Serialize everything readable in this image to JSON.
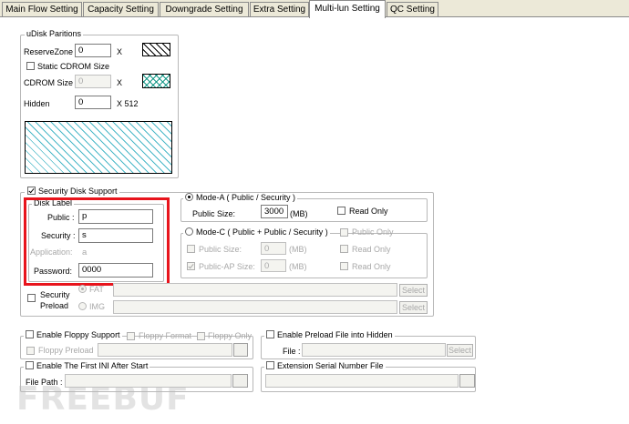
{
  "tabs": [
    {
      "label": "Main Flow Setting"
    },
    {
      "label": "Capacity Setting"
    },
    {
      "label": "Downgrade Setting"
    },
    {
      "label": "Extra Setting"
    },
    {
      "label": "Multi-lun Setting"
    },
    {
      "label": "QC Setting"
    }
  ],
  "udisk": {
    "title": "uDisk Paritions",
    "reserve_zone_label": "ReserveZone",
    "reserve_zone_value": "0",
    "x": "X",
    "static_cdrom_label": "Static CDROM Size",
    "cdrom_size_label": "CDROM Size",
    "cdrom_size_value": "0",
    "hidden_label": "Hidden",
    "hidden_value": "0",
    "x512": "X 512"
  },
  "security": {
    "title": "Security Disk Support",
    "disk_label_title": "Disk Label",
    "public_label": "Public :",
    "public_value": "p",
    "security_label": "Security :",
    "security_value": "s",
    "application_label": "Application:",
    "application_value": "a",
    "password_label": "Password:",
    "password_value": "0000",
    "mode_a_label": "Mode-A ( Public / Security )",
    "public_size_label": "Public Size:",
    "public_size_value": "3000",
    "mb": "(MB)",
    "read_only_label": "Read Only",
    "mode_c_label": "Mode-C ( Public + Public / Security )",
    "public_only_label": "Public Only",
    "mode_c_public_size_label": "Public Size:",
    "mode_c_public_size_value": "0",
    "mode_c_read_only_1": "Read Only",
    "public_ap_size_label": "Public-AP Size:",
    "public_ap_size_value": "0",
    "mode_c_read_only_2": "Read Only",
    "preload_label_1": "Security",
    "preload_label_2": "Preload",
    "fat_label": "FAT",
    "img_label": "IMG",
    "select_label": "Select"
  },
  "floppy": {
    "enable_label": "Enable Floppy Support",
    "floppy_format_label": "Floppy Format",
    "floppy_only_label": "Floppy Only",
    "floppy_preload_label": "Floppy Preload"
  },
  "preload_hidden": {
    "enable_label": "Enable Preload File into Hidden",
    "file_label": "File :",
    "select_label": "Select"
  },
  "first_ini": {
    "enable_label": "Enable The First INI After Start",
    "file_path_label": "File Path :"
  },
  "serial": {
    "label": "Extension Serial Number File"
  },
  "watermark": "FREEBUF",
  "colors": {
    "highlight_box": "#e8141c",
    "hatch_teal": "#4ab8c8"
  }
}
